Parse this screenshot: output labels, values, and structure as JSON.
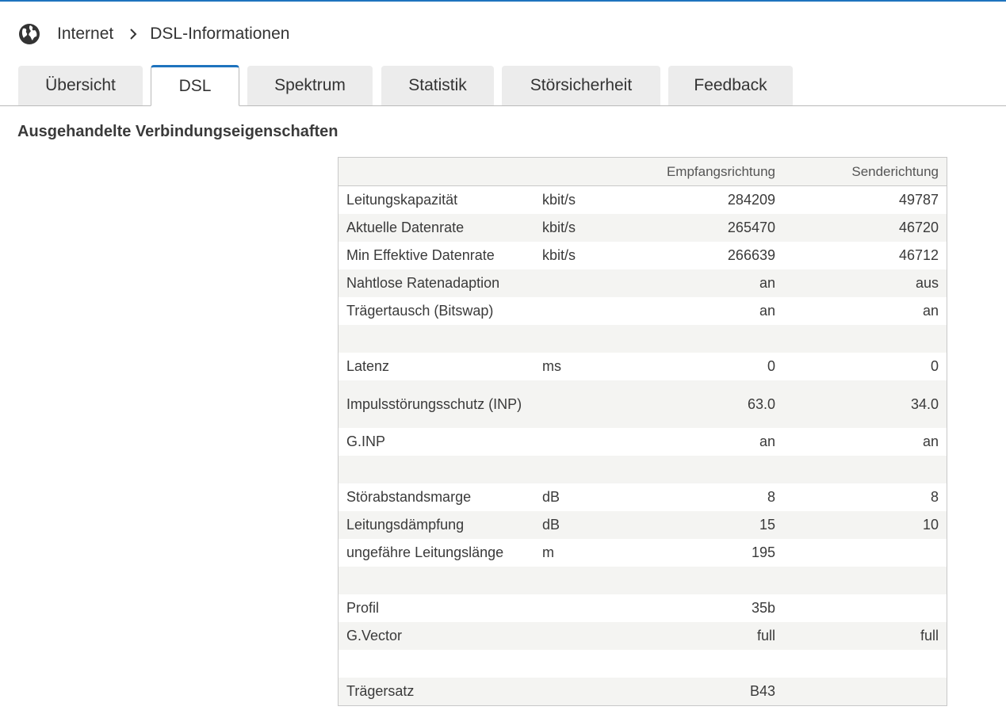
{
  "breadcrumb": {
    "items": [
      "Internet",
      "DSL-Informationen"
    ]
  },
  "tabs": [
    {
      "label": "Übersicht",
      "active": false
    },
    {
      "label": "DSL",
      "active": true
    },
    {
      "label": "Spektrum",
      "active": false
    },
    {
      "label": "Statistik",
      "active": false
    },
    {
      "label": "Störsicherheit",
      "active": false
    },
    {
      "label": "Feedback",
      "active": false
    }
  ],
  "section": {
    "title": "Ausgehandelte Verbindungseigenschaften"
  },
  "table": {
    "headers": [
      "",
      "",
      "Empfangsrichtung",
      "Senderichtung"
    ],
    "rows": [
      {
        "label": "Leitungskapazität",
        "unit": "kbit/s",
        "down": "284209",
        "up": "49787"
      },
      {
        "label": "Aktuelle Datenrate",
        "unit": "kbit/s",
        "down": "265470",
        "up": "46720"
      },
      {
        "label": "Min Effektive Datenrate",
        "unit": "kbit/s",
        "down": "266639",
        "up": "46712"
      },
      {
        "label": "Nahtlose Ratenadaption",
        "unit": "",
        "down": "an",
        "up": "aus"
      },
      {
        "label": "Trägertausch (Bitswap)",
        "unit": "",
        "down": "an",
        "up": "an"
      },
      {
        "label": "",
        "unit": "",
        "down": "",
        "up": ""
      },
      {
        "label": "Latenz",
        "unit": "ms",
        "down": "0",
        "up": "0"
      },
      {
        "label": "Impulsstörungsschutz (INP)",
        "unit": "",
        "down": "63.0",
        "up": "34.0"
      },
      {
        "label": "G.INP",
        "unit": "",
        "down": "an",
        "up": "an"
      },
      {
        "label": "",
        "unit": "",
        "down": "",
        "up": ""
      },
      {
        "label": "Störabstandsmarge",
        "unit": "dB",
        "down": "8",
        "up": "8"
      },
      {
        "label": "Leitungsdämpfung",
        "unit": "dB",
        "down": "15",
        "up": "10"
      },
      {
        "label": "ungefähre Leitungslänge",
        "unit": "m",
        "down": "195",
        "up": ""
      },
      {
        "label": "",
        "unit": "",
        "down": "",
        "up": ""
      },
      {
        "label": "Profil",
        "unit": "",
        "down": "35b",
        "up": ""
      },
      {
        "label": "G.Vector",
        "unit": "",
        "down": "full",
        "up": "full"
      },
      {
        "label": "",
        "unit": "",
        "down": "",
        "up": ""
      },
      {
        "label": "Trägersatz",
        "unit": "",
        "down": "B43",
        "up": ""
      }
    ]
  },
  "icons": {
    "breadcrumb_icon": "globe-icon",
    "separator_icon": "chevron-right-icon"
  },
  "colors": {
    "accent": "#1e73be",
    "tab_inactive": "#ececec",
    "row_alt": "#f4f4f2"
  }
}
